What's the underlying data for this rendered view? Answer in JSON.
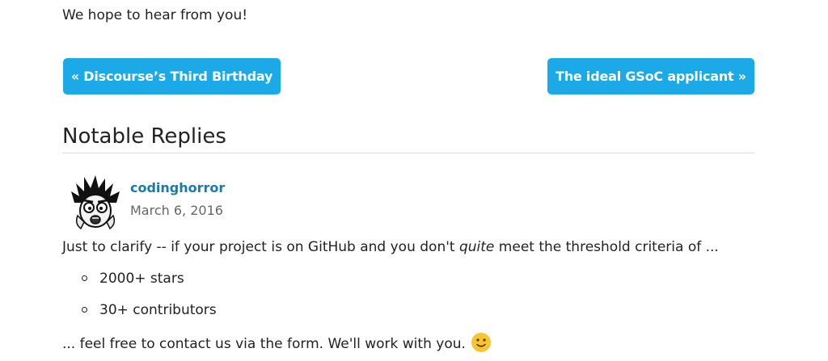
{
  "intro_text": "We hope to hear from you!",
  "navigation": {
    "prev_label": "« Discourse’s Third Birthday",
    "next_label": "The ideal GSoC applicant »"
  },
  "section_title": "Notable Replies",
  "reply": {
    "username": "codinghorror",
    "date": "March 6, 2016",
    "text_before": "Just to clarify -- if your project is on GitHub and you don't ",
    "text_emphasis": "quite",
    "text_after": " meet the threshold criteria of ...",
    "list_items": [
      "2000+ stars",
      "30+ contributors"
    ],
    "outro": "... feel free to contact us via the form. We'll work with you.",
    "emoji": "slightly-smiling-face-icon",
    "avatar": "user-avatar-icon"
  },
  "colors": {
    "button_bg": "#1ba9e8",
    "link": "#1a7aa8",
    "muted": "#666666"
  }
}
